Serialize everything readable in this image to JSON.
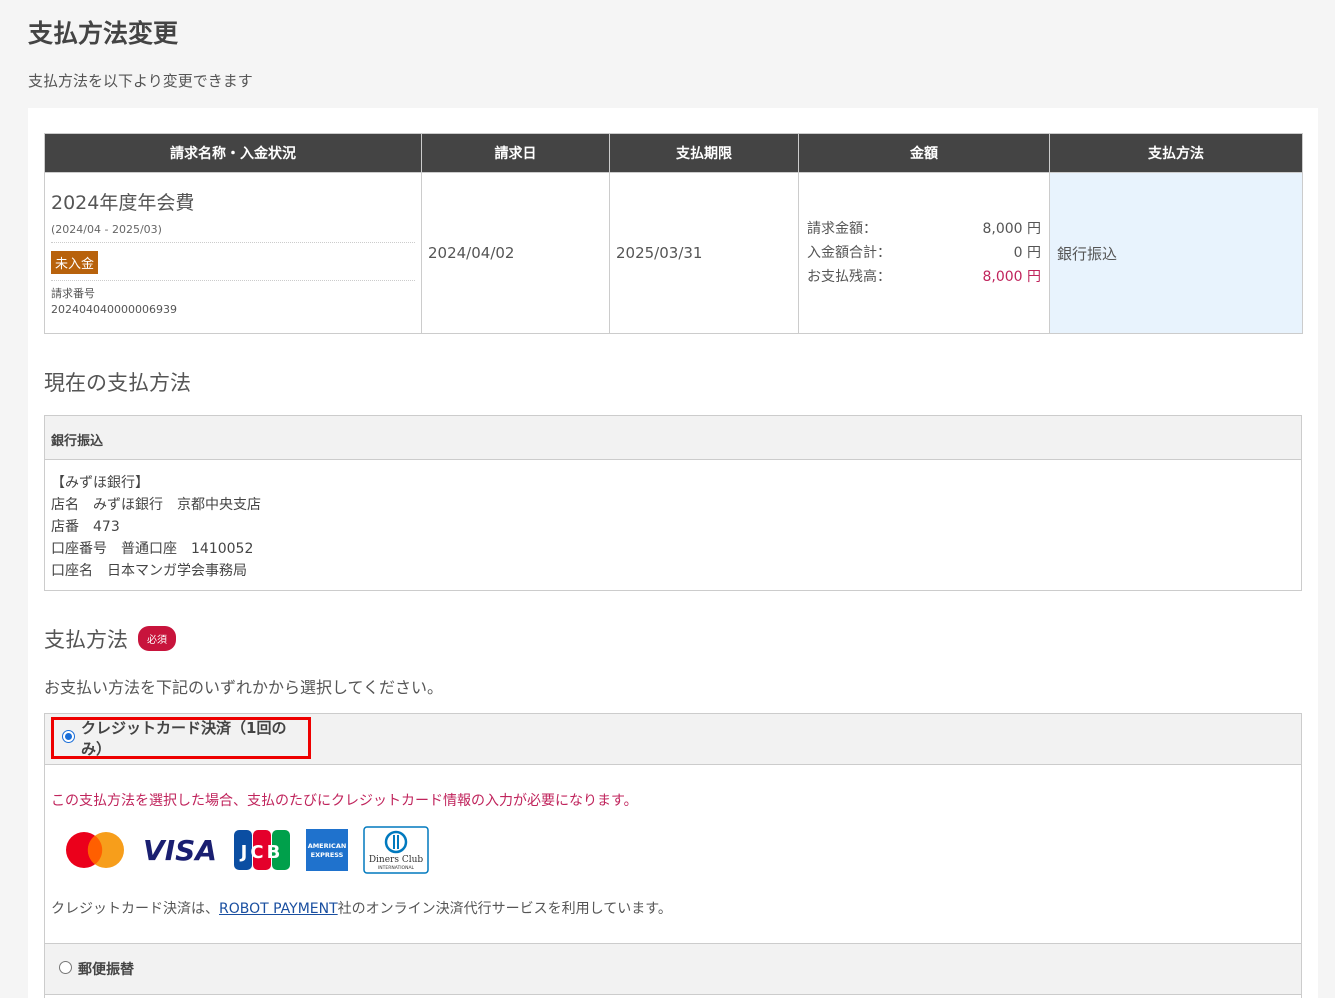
{
  "page": {
    "title": "支払方法変更",
    "subtitle": "支払方法を以下より変更できます"
  },
  "invoice_table": {
    "headers": [
      "請求名称・入金状況",
      "請求日",
      "支払期限",
      "金額",
      "支払方法"
    ],
    "row": {
      "name": "2024年度年会費",
      "period": "(2024/04 - 2025/03)",
      "status": "未入金",
      "invoice_no_label": "請求番号",
      "invoice_no": "202404040000006939",
      "invoice_date": "2024/04/02",
      "due_date": "2025/03/31",
      "amounts": [
        {
          "label": "請求金額：",
          "value": "8,000 円"
        },
        {
          "label": "入金額合計：",
          "value": "0 円"
        },
        {
          "label": "お支払残高：",
          "value": "8,000 円"
        }
      ],
      "method": "銀行振込"
    }
  },
  "current_method": {
    "title": "現在の支払方法",
    "name": "銀行振込",
    "details": [
      "【みずほ銀行】",
      "店名　みずほ銀行　京都中央支店",
      "店番　473",
      "口座番号　普通口座　1410052",
      "口座名　日本マンガ学会事務局"
    ]
  },
  "payment_method": {
    "title": "支払方法",
    "required_badge": "必須",
    "instruction": "お支払い方法を下記のいずれかから選択してください。",
    "options": [
      {
        "label": "クレジットカード決済（1回のみ）",
        "selected": true,
        "warning": "この支払方法を選択した場合、支払のたびにクレジットカード情報の入力が必要になります。",
        "cards": [
          "mastercard-logo",
          "visa-logo",
          "jcb-logo",
          "amex-logo",
          "diners-club-logo"
        ],
        "card_texts": {
          "visa": "VISA",
          "jcb": "JCB",
          "amex_top": "AMERICAN",
          "amex_bottom": "EXPRESS",
          "diners_top": "Diners Club",
          "diners_bottom": "INTERNATIONAL"
        },
        "note_prefix": "クレジットカード決済は、",
        "note_link": "ROBOT PAYMENT",
        "note_suffix": "社のオンライン決済代行サービスを利用しています。"
      },
      {
        "label": "郵便振替",
        "selected": false
      }
    ]
  },
  "colors": {
    "header_bg": "#444444",
    "unpaid_badge": "#b8620c",
    "required_badge": "#c8143c",
    "warning_text": "#c0245c",
    "highlight_border": "#ee0000",
    "method_cell_bg": "#e8f3fd"
  }
}
